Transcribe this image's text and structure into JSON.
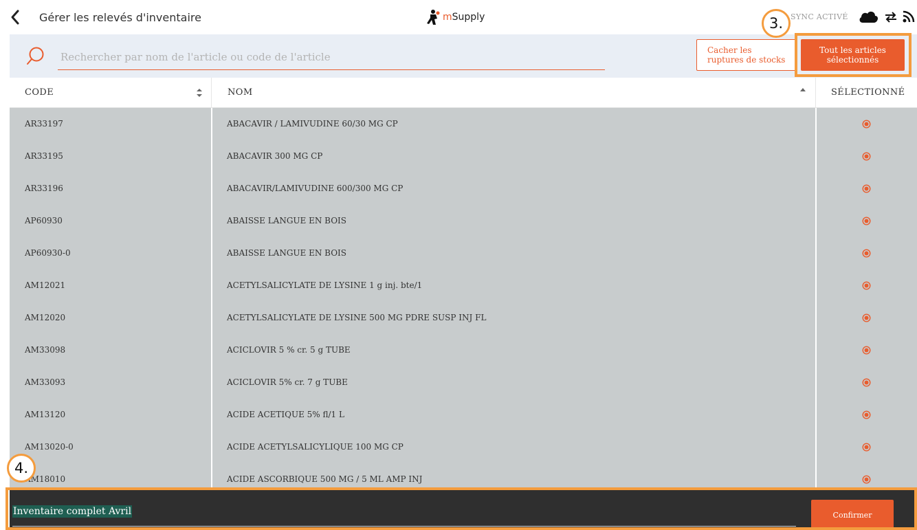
{
  "header": {
    "title": "Gérer les relevés d'inventaire",
    "brand_prefix": "m",
    "brand_suffix": "Supply",
    "sync_status": "SYNC ACTIVÉ"
  },
  "search": {
    "placeholder": "Rechercher par nom de l'article ou code de l'article",
    "value": ""
  },
  "toolbar": {
    "hide_stockouts_label": "Cacher les ruptures de stocks",
    "select_all_label": "Tout les articles sélectionnés"
  },
  "table": {
    "columns": [
      "CODE",
      "NOM",
      "SÉLECTIONNÉ"
    ],
    "rows": [
      {
        "code": "AR33197",
        "name": "ABACAVIR / LAMIVUDINE 60/30 MG CP",
        "selected": true
      },
      {
        "code": "AR33195",
        "name": "ABACAVIR 300 MG CP",
        "selected": true
      },
      {
        "code": "AR33196",
        "name": "ABACAVIR/LAMIVUDINE 600/300 MG CP",
        "selected": true
      },
      {
        "code": "AP60930",
        "name": "ABAISSE LANGUE EN BOIS",
        "selected": true
      },
      {
        "code": "AP60930-0",
        "name": "ABAISSE LANGUE EN BOIS",
        "selected": true
      },
      {
        "code": "AM12021",
        "name": "ACETYLSALICYLATE DE LYSINE 1 g inj. bte/1",
        "selected": true
      },
      {
        "code": "AM12020",
        "name": "ACETYLSALICYLATE DE LYSINE 500 MG PDRE SUSP INJ FL",
        "selected": true
      },
      {
        "code": "AM33098",
        "name": "ACICLOVIR 5 % cr. 5 g TUBE",
        "selected": true
      },
      {
        "code": "AM33093",
        "name": "ACICLOVIR 5% cr. 7 g TUBE",
        "selected": true
      },
      {
        "code": "AM13120",
        "name": "ACIDE ACETIQUE 5% fl/1 L",
        "selected": true
      },
      {
        "code": "AM13020-0",
        "name": "ACIDE ACETYLSALICYLIQUE  100 MG CP",
        "selected": true
      },
      {
        "code": "AM18010",
        "name": "ACIDE ASCORBIQUE 500 MG / 5 ML AMP INJ",
        "selected": true
      }
    ]
  },
  "footer": {
    "stocktake_name": "Inventaire complet Avril",
    "confirm_label": "Confirmer"
  },
  "annotations": {
    "step3": "3.",
    "step4": "4."
  },
  "colors": {
    "accent": "#e95c2d",
    "highlight": "#f49c3e",
    "table_bg": "#c8cccd",
    "search_bg": "#e9eef5",
    "footer_bg": "#2f2f2f"
  }
}
